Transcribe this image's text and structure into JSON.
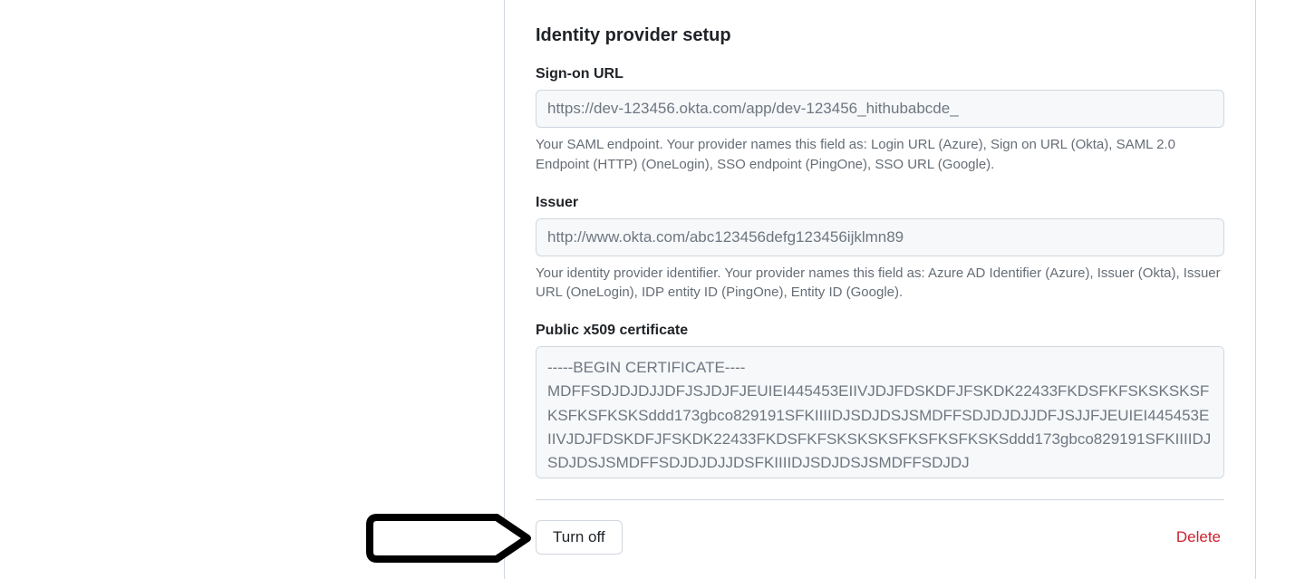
{
  "section": {
    "title": "Identity provider setup"
  },
  "signon": {
    "label": "Sign-on URL",
    "placeholder": "https://dev-123456.okta.com/app/dev-123456_hithubabcde_",
    "help": "Your SAML endpoint. Your provider names this field as: Login URL (Azure), Sign on URL (Okta), SAML 2.0 Endpoint (HTTP) (OneLogin), SSO endpoint (PingOne), SSO URL (Google)."
  },
  "issuer": {
    "label": "Issuer",
    "placeholder": "http://www.okta.com/abc123456defg123456ijklmn89",
    "help": "Your identity provider identifier. Your provider names this field as: Azure AD Identifier (Azure), Issuer (Okta), Issuer URL (OneLogin), IDP entity ID (PingOne), Entity ID (Google)."
  },
  "cert": {
    "label": "Public x509 certificate",
    "value": "-----BEGIN CERTIFICATE----\nMDFFSDJDJDJJDFJSJDJFJEUIEI445453EIIVJDJFDSKDFJFSKDK22433FKDSFKFSKSKSKSFKSFKSFKSKSddd173gbco829191SFKIIIIDJSDJDSJSMDFFSDJDJDJJDFJSJJFJEUIEI445453EIIVJDJFDSKDFJFSKDK22433FKDSFKFSKSKSKSFKSFKSFKSKSddd173gbco829191SFKIIIIDJSDJDSJSMDFFSDJDJDJJDSFKIIIIDJSDJDSJSMDFFSDJDJ"
  },
  "actions": {
    "turnoff": "Turn off",
    "delete": "Delete"
  }
}
